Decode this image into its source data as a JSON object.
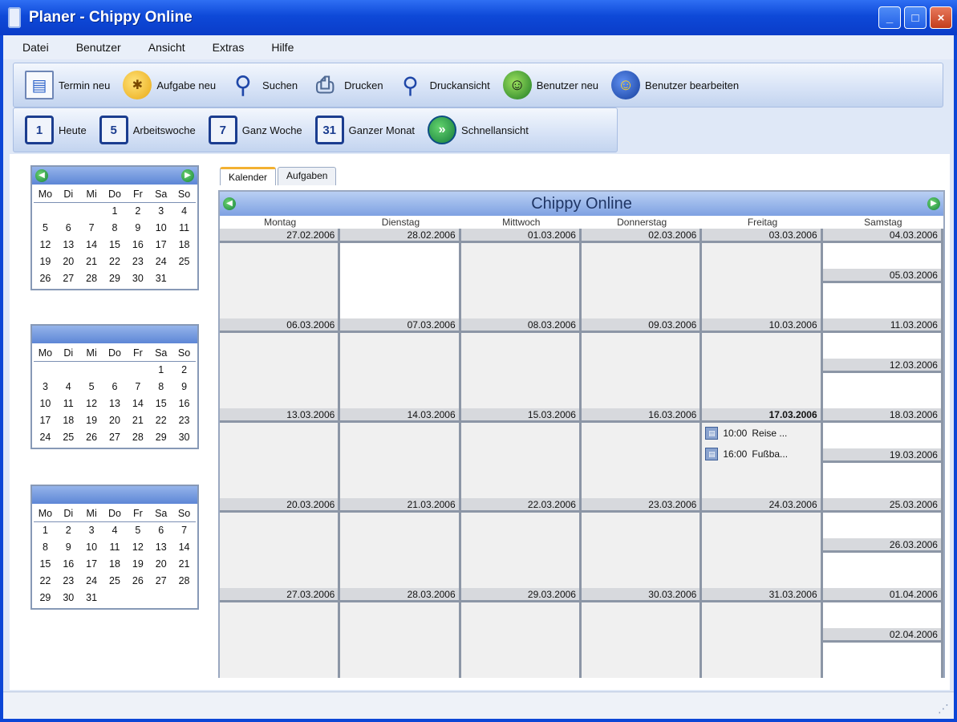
{
  "window": {
    "title": "Planer - Chippy Online"
  },
  "menu": [
    "Datei",
    "Benutzer",
    "Ansicht",
    "Extras",
    "Hilfe"
  ],
  "toolbar1": [
    {
      "label": "Termin neu",
      "icon": "new-appointment-icon",
      "glyph": "▤"
    },
    {
      "label": "Aufgabe neu",
      "icon": "new-task-icon",
      "glyph": "✱"
    },
    {
      "label": "Suchen",
      "icon": "search-icon",
      "glyph": "⚲"
    },
    {
      "label": "Drucken",
      "icon": "print-icon",
      "glyph": "⎙"
    },
    {
      "label": "Druckansicht",
      "icon": "print-preview-icon",
      "glyph": "⚲"
    },
    {
      "label": "Benutzer neu",
      "icon": "new-user-icon",
      "glyph": "☺"
    },
    {
      "label": "Benutzer bearbeiten",
      "icon": "edit-user-icon",
      "glyph": "☺"
    }
  ],
  "toolbar2": [
    {
      "label": "Heute",
      "icon": "today-calendar-icon",
      "glyph": "1"
    },
    {
      "label": "Arbeitswoche",
      "icon": "workweek-calendar-icon",
      "glyph": "5"
    },
    {
      "label": "Ganz Woche",
      "icon": "week-calendar-icon",
      "glyph": "7"
    },
    {
      "label": "Ganzer Monat",
      "icon": "month-calendar-icon",
      "glyph": "31"
    },
    {
      "label": "Schnellansicht",
      "icon": "quick-view-icon",
      "glyph": "»"
    }
  ],
  "mini_calendars": [
    {
      "header": "",
      "weekdays": [
        "Mo",
        "Di",
        "Mi",
        "Do",
        "Fr",
        "Sa",
        "So"
      ],
      "days": [
        "",
        "",
        "",
        "1",
        "2",
        "3",
        "4",
        "5",
        "6",
        "7",
        "8",
        "9",
        "10",
        "11",
        "12",
        "13",
        "14",
        "15",
        "16",
        "17",
        "18",
        "19",
        "20",
        "21",
        "22",
        "23",
        "24",
        "25",
        "26",
        "27",
        "28",
        "29",
        "30",
        "31"
      ],
      "pad_first": 3
    },
    {
      "header": "",
      "weekdays": [
        "Mo",
        "Di",
        "Mi",
        "Do",
        "Fr",
        "Sa",
        "So"
      ],
      "days": [
        "1",
        "2",
        "3",
        "4",
        "5",
        "6",
        "7",
        "8",
        "9",
        "10",
        "11",
        "12",
        "13",
        "14",
        "15",
        "16",
        "17",
        "18",
        "19",
        "20",
        "21",
        "22",
        "23",
        "24",
        "25",
        "26",
        "27",
        "28",
        "29",
        "30"
      ],
      "pad_first": 5
    },
    {
      "header": "",
      "weekdays": [
        "Mo",
        "Di",
        "Mi",
        "Do",
        "Fr",
        "Sa",
        "So"
      ],
      "days": [
        "1",
        "2",
        "3",
        "4",
        "5",
        "6",
        "7",
        "8",
        "9",
        "10",
        "11",
        "12",
        "13",
        "14",
        "15",
        "16",
        "17",
        "18",
        "19",
        "20",
        "21",
        "22",
        "23",
        "24",
        "25",
        "26",
        "27",
        "28",
        "29",
        "30",
        "31"
      ],
      "pad_first": 0
    }
  ],
  "tabs": [
    "Kalender",
    "Aufgaben"
  ],
  "month_view": {
    "title": "Chippy Online",
    "weekdays": [
      "Montag",
      "Dienstag",
      "Mittwoch",
      "Donnerstag",
      "Freitag",
      "Samstag"
    ],
    "weeks": [
      {
        "dates": [
          "27.02.2006",
          "28.02.2006",
          "01.03.2006",
          "02.03.2006",
          "03.03.2006"
        ],
        "sat": "04.03.2006",
        "sun": "05.03.2006"
      },
      {
        "dates": [
          "06.03.2006",
          "07.03.2006",
          "08.03.2006",
          "09.03.2006",
          "10.03.2006"
        ],
        "sat": "11.03.2006",
        "sun": "12.03.2006"
      },
      {
        "dates": [
          "13.03.2006",
          "14.03.2006",
          "15.03.2006",
          "16.03.2006",
          "17.03.2006"
        ],
        "sat": "18.03.2006",
        "sun": "19.03.2006"
      },
      {
        "dates": [
          "20.03.2006",
          "21.03.2006",
          "22.03.2006",
          "23.03.2006",
          "24.03.2006"
        ],
        "sat": "25.03.2006",
        "sun": "26.03.2006"
      },
      {
        "dates": [
          "27.03.2006",
          "28.03.2006",
          "29.03.2006",
          "30.03.2006",
          "31.03.2006"
        ],
        "sat": "01.04.2006",
        "sun": "02.04.2006"
      }
    ],
    "events": [
      {
        "week": 2,
        "day": 4,
        "time": "10:00",
        "text": "Reise ..."
      },
      {
        "week": 2,
        "day": 4,
        "time": "16:00",
        "text": "Fußba..."
      }
    ]
  }
}
